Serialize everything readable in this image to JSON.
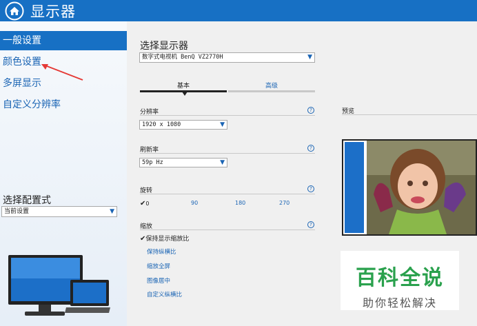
{
  "window": {
    "title": "显示器"
  },
  "sidebar": {
    "items": [
      {
        "label": "一般设置",
        "active": true
      },
      {
        "label": "颜色设置",
        "active": false
      },
      {
        "label": "多屏显示",
        "active": false
      },
      {
        "label": "自定义分辨率",
        "active": false
      }
    ],
    "profile_label": "选择配置式",
    "profile_value": "当前设置"
  },
  "main": {
    "section_title": "选择显示器",
    "monitor_value": "数字式电视机 BenQ VZ2770H",
    "tabs": [
      {
        "label": "基本",
        "active": true
      },
      {
        "label": "高级",
        "active": false
      }
    ],
    "resolution": {
      "label": "分辨率",
      "value": "1920 x 1080"
    },
    "refresh": {
      "label": "刷新率",
      "value": "59p Hz"
    },
    "rotation": {
      "label": "旋转",
      "options": [
        "0",
        "90",
        "180",
        "270"
      ],
      "selected": "0"
    },
    "scaling": {
      "label": "缩放",
      "keep_label": "保持显示缩放比",
      "options": [
        "保持纵横比",
        "缩放全屏",
        "图像居中",
        "自定义纵横比"
      ]
    },
    "preview_label": "预览"
  },
  "watermark": {
    "title": "百科全说",
    "subtitle": "助你轻松解决"
  },
  "colors": {
    "accent": "#1770c4",
    "link": "#1a64b4",
    "annotation": "#e53935",
    "watermark": "#2aa14d"
  },
  "icons": {
    "home": "home-icon",
    "help": "help-icon",
    "dropdown": "chevron-down-icon",
    "check": "checkmark-icon"
  }
}
